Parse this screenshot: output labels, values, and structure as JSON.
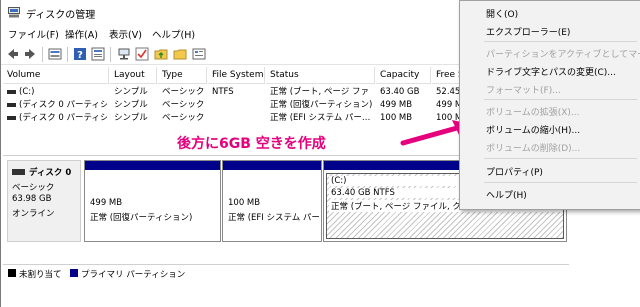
{
  "window": {
    "title": "ディスクの管理",
    "menu": [
      "ファイル(F)",
      "操作(A)",
      "表示(V)",
      "ヘルプ(H)"
    ]
  },
  "toolbar": {
    "icons": [
      "back-icon",
      "forward-icon",
      "disk-list-icon",
      "help-icon",
      "properties-icon",
      "connect-icon",
      "check-icon",
      "folder-up-icon",
      "folder-icon",
      "settings-icon"
    ]
  },
  "volume_table": {
    "columns": [
      "Volume",
      "Layout",
      "Type",
      "File System",
      "Status",
      "Capacity",
      "Free S"
    ],
    "rows": [
      [
        "(C:)",
        "シンプル",
        "ベーシック",
        "NTFS",
        "正常 (ブート, ページ ファ",
        "63.40 GB",
        "52.45"
      ],
      [
        "(ディスク 0 パーティシ…",
        "シンプル",
        "ベーシック",
        "",
        "正常 (回復パーティション)",
        "499 MB",
        "499 M"
      ],
      [
        "(ディスク 0 パーティシ…",
        "シンプル",
        "ベーシック",
        "",
        "正常 (EFI システム パー…",
        "100 MB",
        "100 M"
      ]
    ]
  },
  "annotation": {
    "text": "後方に6GB 空きを作成"
  },
  "disk": {
    "name": "ディスク 0",
    "type": "ベーシック",
    "size": "63.98 GB",
    "state": "オンライン",
    "partitions": [
      {
        "label": "",
        "size": "499 MB",
        "status": "正常 (回復パーティション)"
      },
      {
        "label": "",
        "size": "100 MB",
        "status": "正常 (EFI システム パー"
      },
      {
        "label": "(C:)",
        "size": "63.40 GB NTFS",
        "status": "正常 (ブート, ページ ファイル, クラッシュ ダンプ, プライマリ パーテ"
      }
    ]
  },
  "legend": {
    "unallocated": "未割り当て",
    "primary": "プライマリ パーティション",
    "unallocated_color": "#000000",
    "primary_color": "#00008b"
  },
  "context_menu": {
    "items": [
      {
        "label": "開く(O)",
        "enabled": true
      },
      {
        "label": "エクスプローラー(E)",
        "enabled": true
      },
      {
        "label": "パーティションをアクティブとしてマーク(M)",
        "enabled": false
      },
      {
        "label": "ドライブ文字とパスの変更(C)...",
        "enabled": true
      },
      {
        "label": "フォーマット(F)...",
        "enabled": false
      },
      {
        "label": "ボリュームの拡張(X)...",
        "enabled": false
      },
      {
        "label": "ボリュームの縮小(H)...",
        "enabled": true
      },
      {
        "label": "ボリュームの削除(D)...",
        "enabled": false
      },
      {
        "label": "プロパティ(P)",
        "enabled": true
      },
      {
        "label": "ヘルプ(H)",
        "enabled": true
      }
    ]
  },
  "colors": {
    "accent_pink": "#e5007e",
    "partition_bar": "#00008b"
  }
}
